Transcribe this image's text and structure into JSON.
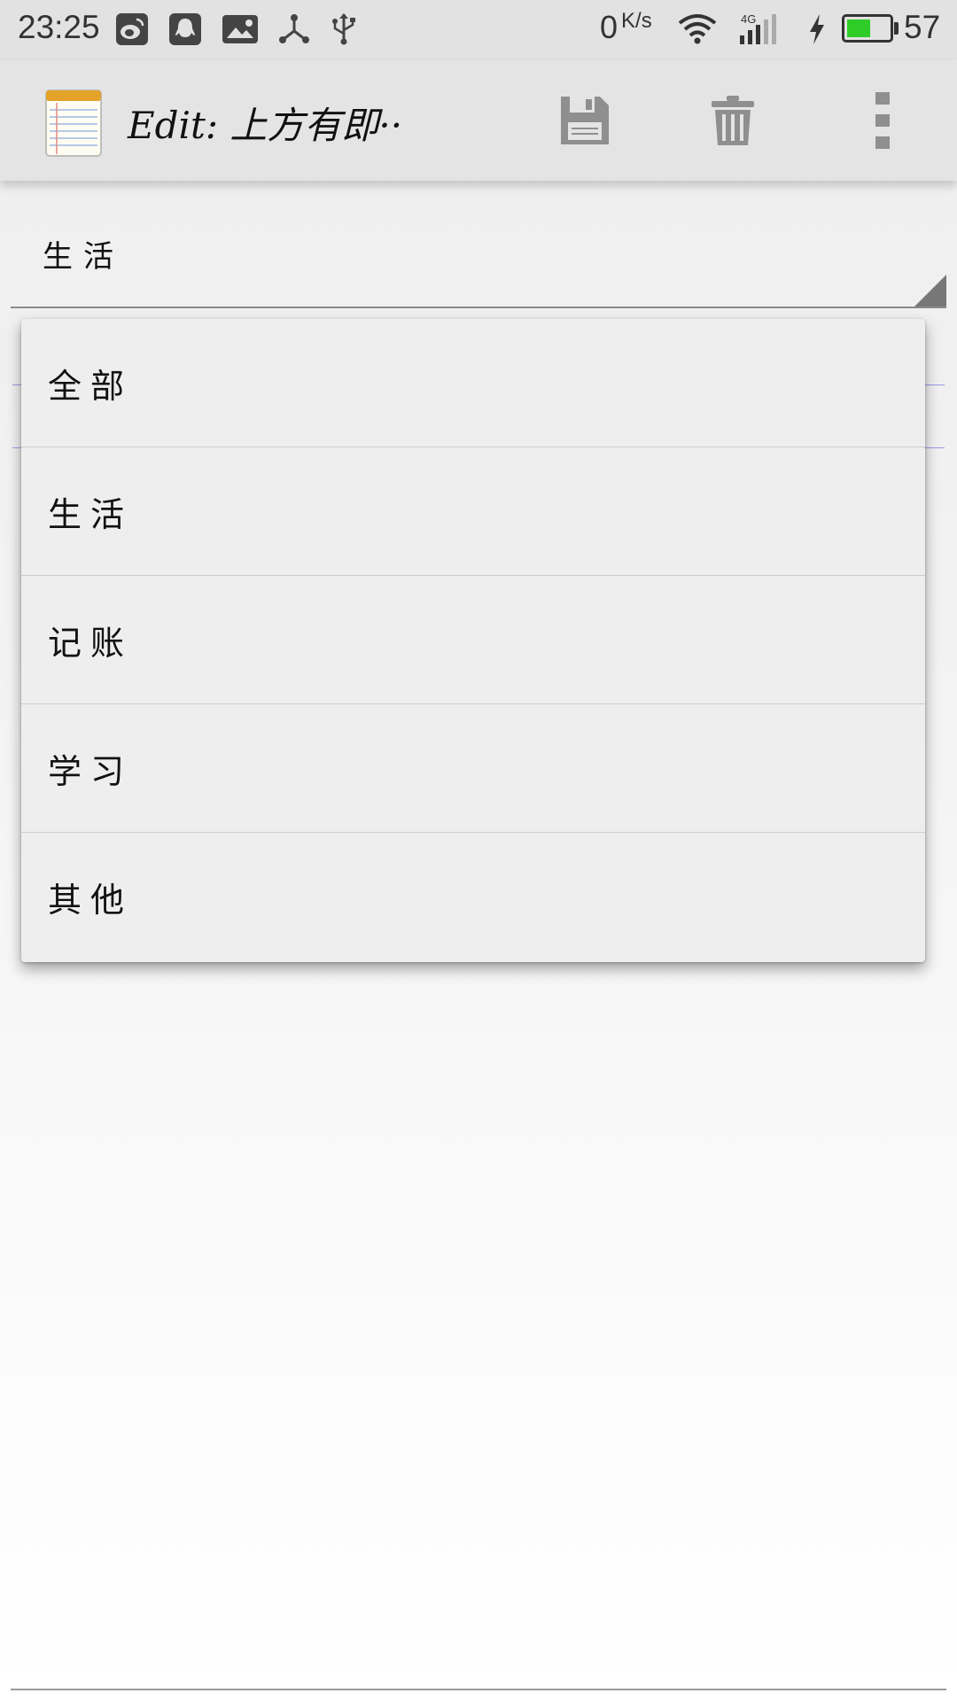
{
  "status_bar": {
    "time": "23:25",
    "net_speed_value": "0",
    "net_speed_unit": "K/s",
    "signal_label": "4G",
    "battery_percent": "57",
    "battery_level": 0.57,
    "icons": [
      "weibo-icon",
      "qq-icon",
      "gallery-icon",
      "share-icon",
      "usb-icon",
      "wifi-icon",
      "signal-icon",
      "charging-icon",
      "battery-icon"
    ]
  },
  "action_bar": {
    "title": "Edit: 上方有即··",
    "app_icon": "notepad-icon",
    "actions": [
      "save-icon",
      "delete-icon",
      "overflow-menu-icon"
    ]
  },
  "spinner": {
    "selected": "生活"
  },
  "dropdown": {
    "items": [
      {
        "label": "全部"
      },
      {
        "label": "生活"
      },
      {
        "label": "记账"
      },
      {
        "label": "学习"
      },
      {
        "label": "其他"
      }
    ]
  },
  "colors": {
    "status_bar_bg": "#e2e2e2",
    "action_bar_bg": "#e4e4e4",
    "battery_fill": "#2fcc27",
    "popup_bg": "#eeeeee",
    "icon_gray": "#8f8f8f"
  }
}
